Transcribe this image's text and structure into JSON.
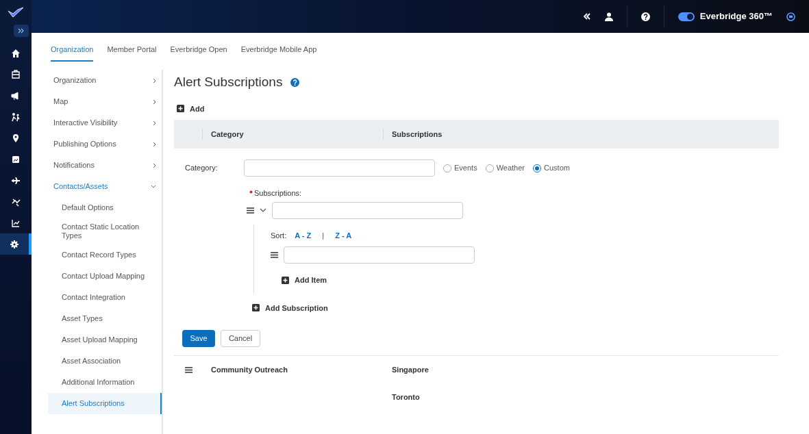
{
  "rail": {
    "items": [
      {
        "selected": false
      },
      {
        "selected": false
      },
      {
        "selected": false
      },
      {
        "selected": false
      },
      {
        "selected": false
      },
      {
        "selected": false
      },
      {
        "selected": false
      },
      {
        "selected": false
      },
      {
        "selected": false
      },
      {
        "selected": true
      }
    ]
  },
  "header": {
    "toggle": {
      "on": true
    },
    "product": "Everbridge 360™"
  },
  "tabs": [
    {
      "label": "Organization",
      "selected": true
    },
    {
      "label": "Member Portal",
      "selected": false
    },
    {
      "label": "Everbridge Open",
      "selected": false
    },
    {
      "label": "Everbridge Mobile App",
      "selected": false
    }
  ],
  "sidebar": {
    "items": [
      {
        "label": "Organization",
        "expanded": false,
        "selected": false
      },
      {
        "label": "Map",
        "expanded": false,
        "selected": false
      },
      {
        "label": "Interactive Visibility",
        "expanded": false,
        "selected": false
      },
      {
        "label": "Publishing Options",
        "expanded": false,
        "selected": false
      },
      {
        "label": "Notifications",
        "expanded": false,
        "selected": false
      },
      {
        "label": "Contacts/Assets",
        "expanded": true,
        "selected": true,
        "children": [
          {
            "label": "Default Options",
            "selected": false
          },
          {
            "label": "Contact Static Location Types",
            "selected": false
          },
          {
            "label": "Contact Record Types",
            "selected": false
          },
          {
            "label": "Contact Upload Mapping",
            "selected": false
          },
          {
            "label": "Contact Integration",
            "selected": false
          },
          {
            "label": "Asset Types",
            "selected": false
          },
          {
            "label": "Asset Upload Mapping",
            "selected": false
          },
          {
            "label": "Asset Association",
            "selected": false
          },
          {
            "label": "Additional Information",
            "selected": false
          },
          {
            "label": "Alert Subscriptions",
            "selected": true
          }
        ]
      }
    ]
  },
  "page": {
    "title": "Alert Subscriptions",
    "add": "Add",
    "table": {
      "columns": [
        "Category",
        "Subscriptions"
      ],
      "rows": [
        {
          "category": "Community Outreach",
          "subscriptions": [
            "Singapore",
            "Toronto"
          ]
        }
      ]
    },
    "form": {
      "category_label": "Category:",
      "category_types": [
        {
          "label": "Events",
          "selected": false
        },
        {
          "label": "Weather",
          "selected": false
        },
        {
          "label": "Custom",
          "selected": true
        }
      ],
      "subscriptions_label": "Subscriptions:",
      "required": true,
      "sort_label": "Sort:",
      "sort_options": [
        "A - Z",
        "Z - A"
      ],
      "sort_separator": "|",
      "add_item": "Add Item",
      "add_subscription": "Add Subscription",
      "save": "Save",
      "cancel": "Cancel"
    }
  }
}
